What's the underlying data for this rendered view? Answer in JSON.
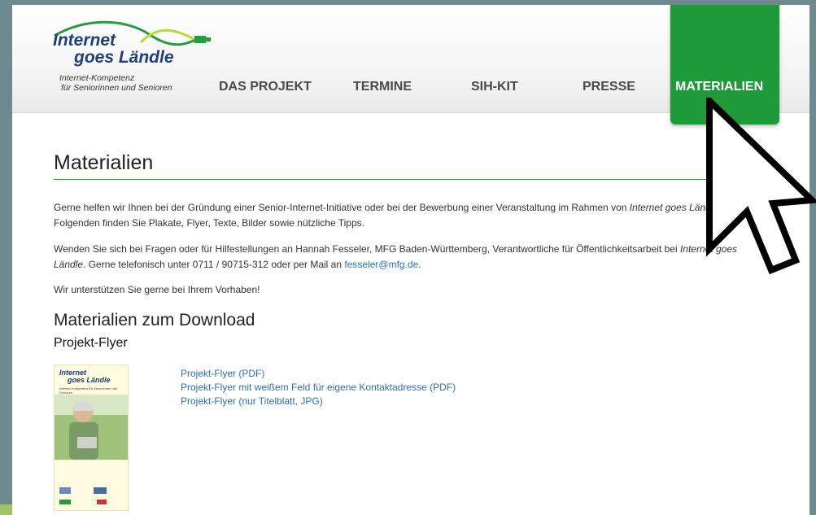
{
  "logo": {
    "line1": "Internet",
    "line2": "goes Ländle",
    "sub1": "Internet-Kompetenz",
    "sub2": "für Seniorinnen und Senioren"
  },
  "nav": {
    "items": [
      "DAS PROJEKT",
      "TERMINE",
      "SIH-KIT",
      "PRESSE"
    ],
    "active": "MATERIALIEN"
  },
  "main": {
    "title": "Materialien",
    "p1a": "Gerne helfen wir Ihnen bei der Gründung einer Senior-Internet-Initiative oder bei der Bewerbung einer Veranstaltung im Rahmen von ",
    "p1em": "Internet goes Ländle",
    "p1b": " weiter. Im Folgenden finden Sie Plakate, Flyer, Texte, Bilder sowie nützliche Tipps.",
    "p2a": "Wenden Sie sich bei Fragen oder für Hilfestellungen an Hannah Fesseler, MFG Baden-Württemberg, Verantwortliche für Öffentlichkeitsarbeit bei ",
    "p2em": "Internet goes Ländle",
    "p2b": ". Gerne telefonisch unter 0711 / 90715-312 oder per Mail an ",
    "email": "fesseler@mfg.de",
    "p2c": ".",
    "p3": "Wir unterstützen Sie gerne bei Ihrem Vorhaben!",
    "download_title": "Materialien zum Download",
    "flyer_title": "Projekt-Flyer",
    "links": [
      "Projekt-Flyer (PDF)",
      "Projekt-Flyer mit weißem Feld für eigene Kontaktadresse (PDF)",
      "Projekt-Flyer (nur Titelblatt, JPG)"
    ]
  },
  "flyer_thumb": {
    "line1": "Internet",
    "line2": "goes Ländle",
    "sub": "Internet-Kompetenz für Seniorinnen und Senioren"
  },
  "colors": {
    "accent_green": "#1f9a3b",
    "link_blue": "#2d6fb5",
    "logo_blue": "#1d3f7a"
  }
}
